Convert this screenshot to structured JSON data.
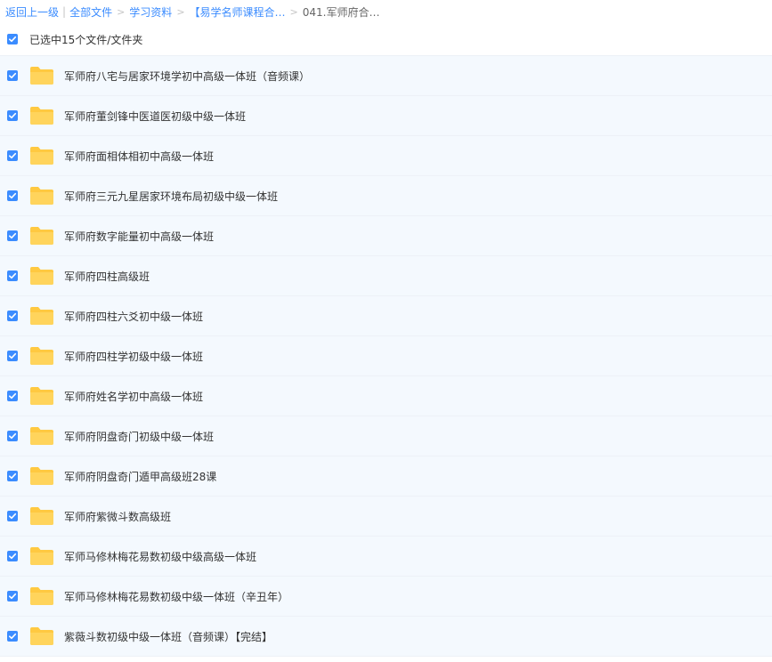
{
  "breadcrumb": {
    "back": "返回上一级",
    "root": "全部文件",
    "level1": "学习资料",
    "level2": "【易学名师课程合…",
    "current": "041.军师府合…"
  },
  "selection": {
    "label": "已选中15个文件/文件夹"
  },
  "files": [
    {
      "name": "军师府八宅与居家环境学初中高级一体班（音频课）"
    },
    {
      "name": "军师府董剑锋中医道医初级中级一体班"
    },
    {
      "name": "军师府面相体相初中高级一体班"
    },
    {
      "name": "军师府三元九星居家环境布局初级中级一体班"
    },
    {
      "name": "军师府数字能量初中高级一体班"
    },
    {
      "name": "军师府四柱高级班"
    },
    {
      "name": "军师府四柱六爻初中级一体班"
    },
    {
      "name": "军师府四柱学初级中级一体班"
    },
    {
      "name": "军师府姓名学初中高级一体班"
    },
    {
      "name": "军师府阴盘奇门初级中级一体班"
    },
    {
      "name": "军师府阴盘奇门遁甲高级班28课"
    },
    {
      "name": "军师府紫微斗数高级班"
    },
    {
      "name": "军师马修林梅花易数初级中级高级一体班"
    },
    {
      "name": "军师马修林梅花易数初级中级一体班（辛丑年）"
    },
    {
      "name": "紫薇斗数初级中级一体班（音频课）【完结】"
    }
  ],
  "colors": {
    "accent": "#3b8cff",
    "folder": "#ffd45c",
    "row_bg": "#f4f9fe"
  }
}
